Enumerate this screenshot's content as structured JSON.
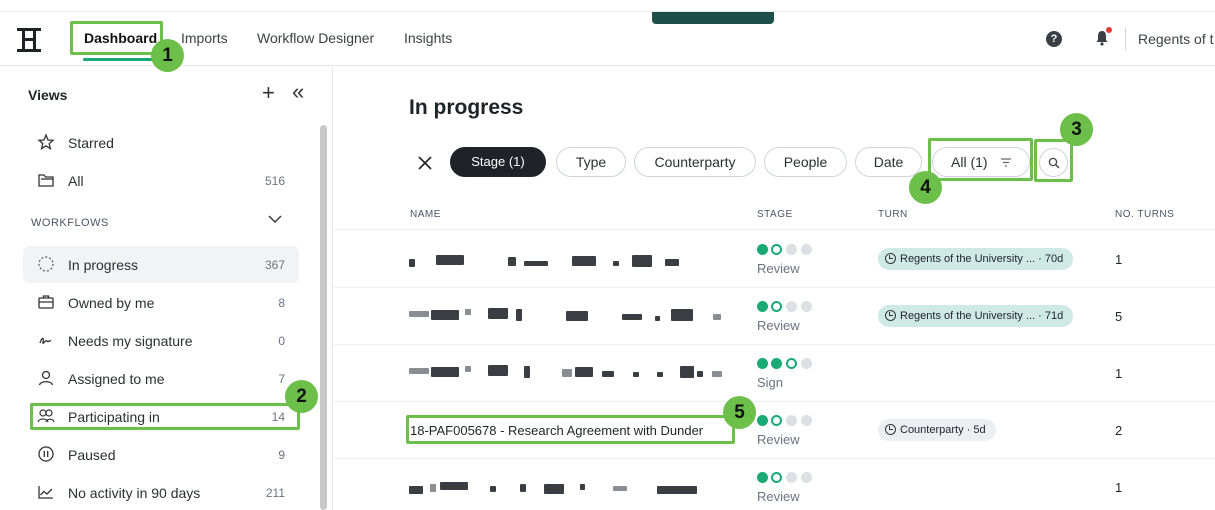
{
  "nav": {
    "tabs": [
      "Dashboard",
      "Imports",
      "Workflow Designer",
      "Insights"
    ],
    "org_name": "Regents of t",
    "help_glyph": "?"
  },
  "sidebar": {
    "title": "Views",
    "plus_glyph": "+",
    "collapse_glyph": "«",
    "items_top": [
      {
        "label": "Starred",
        "count": ""
      },
      {
        "label": "All",
        "count": "516"
      }
    ],
    "section_label": "WORKFLOWS",
    "items": [
      {
        "label": "In progress",
        "count": "367"
      },
      {
        "label": "Owned by me",
        "count": "8"
      },
      {
        "label": "Needs my signature",
        "count": "0"
      },
      {
        "label": "Assigned to me",
        "count": "7"
      },
      {
        "label": "Participating in",
        "count": "14"
      },
      {
        "label": "Paused",
        "count": "9"
      },
      {
        "label": "No activity in 90 days",
        "count": "211"
      }
    ]
  },
  "main": {
    "title": "In progress",
    "filters": [
      "Stage (1)",
      "Type",
      "Counterparty",
      "People",
      "Date",
      "All (1)"
    ],
    "columns": [
      "NAME",
      "STAGE",
      "TURN",
      "NO. TURNS"
    ],
    "rows": [
      {
        "name": "",
        "stage": "Review",
        "dots": [
          "filled",
          "ring",
          "empty",
          "empty"
        ],
        "turn": "Regents of the University ... · 70d",
        "turn_style": "teal",
        "turns": "1"
      },
      {
        "name": "",
        "stage": "Review",
        "dots": [
          "filled",
          "ring",
          "empty",
          "empty"
        ],
        "turn": "Regents of the University ... · 71d",
        "turn_style": "teal",
        "turns": "5"
      },
      {
        "name": "",
        "stage": "Sign",
        "dots": [
          "filled",
          "filled",
          "ring",
          "empty"
        ],
        "turn": "",
        "turn_style": "",
        "turns": "1"
      },
      {
        "name": "18-PAF005678 - Research Agreement with Dunder",
        "stage": "Review",
        "dots": [
          "filled",
          "ring",
          "empty",
          "empty"
        ],
        "turn": "Counterparty · 5d",
        "turn_style": "grey",
        "turns": "2"
      },
      {
        "name": "",
        "stage": "Review",
        "dots": [
          "filled",
          "ring",
          "empty",
          "empty"
        ],
        "turn": "",
        "turn_style": "",
        "turns": "1"
      }
    ]
  },
  "annotations": {
    "badges": [
      "1",
      "2",
      "3",
      "4",
      "5"
    ]
  },
  "colors": {
    "accent": "#19a974",
    "highlight": "#6cc04a",
    "teal_chip": "#cfe9e5",
    "dark_pill": "#1f2328",
    "brand_tab": "#1e4f4a"
  },
  "icons": {
    "logo": "logo-icon",
    "help": "help-icon",
    "bell": "bell-icon",
    "starred": "star-icon",
    "all": "folder-icon",
    "search": "search-icon"
  }
}
